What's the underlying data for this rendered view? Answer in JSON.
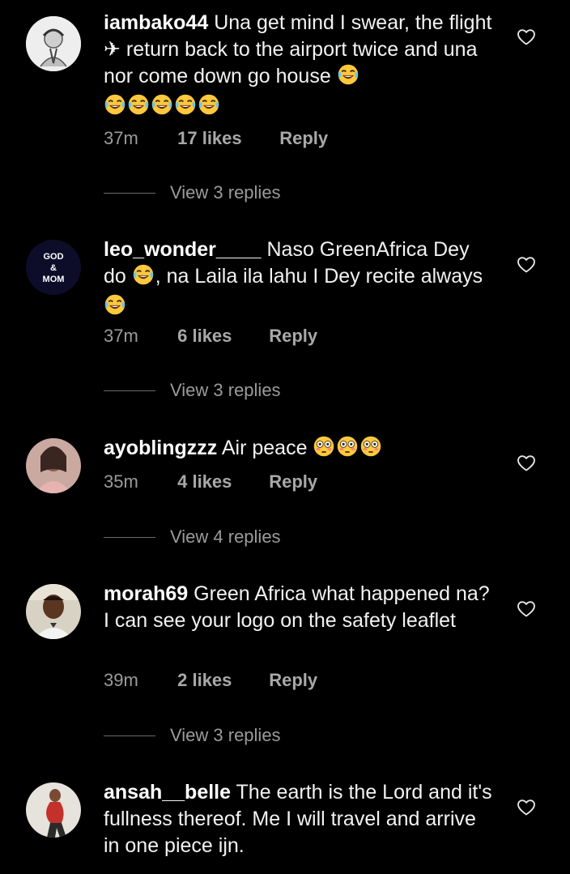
{
  "comments": [
    {
      "username": "iambako44",
      "text_parts": [
        "Una get mind I swear,  the flight ",
        " return back to the airport twice and una nor come down go house "
      ],
      "time": "37m",
      "likes": "17 likes",
      "reply": "Reply",
      "view_replies": "View 3 replies",
      "avatar_icon": "avatar-sketch-icon"
    },
    {
      "username": "leo_wonder____",
      "text_parts": [
        "Naso GreenAfrica Dey do ",
        ", na Laila ila lahu I Dey recite always "
      ],
      "time": "37m",
      "likes": "6 likes",
      "reply": "Reply",
      "view_replies": "View 3 replies",
      "avatar_text": [
        "GOD",
        "&",
        "MOM"
      ]
    },
    {
      "username": "ayoblingzzz",
      "text_parts": [
        "Air peace "
      ],
      "time": "35m",
      "likes": "4 likes",
      "reply": "Reply",
      "view_replies": "View 4 replies",
      "avatar_icon": "avatar-photo-icon"
    },
    {
      "username": "morah69",
      "text_parts": [
        "Green Africa what happened na? I can see your logo on the safety leaflet"
      ],
      "time": "39m",
      "likes": "2 likes",
      "reply": "Reply",
      "view_replies": "View 3 replies",
      "avatar_icon": "avatar-photo-icon"
    },
    {
      "username": "ansah__belle",
      "text_parts": [
        "The earth is the Lord and it's fullness thereof.  Me I will travel and arrive in one piece ijn."
      ],
      "avatar_icon": "avatar-photo-icon"
    }
  ],
  "icons": {
    "like": "heart-outline-icon",
    "airplane": "airplane-icon",
    "laugh": "tears-of-joy-emoji-icon",
    "flushed": "flushed-face-emoji-icon"
  },
  "colors": {
    "background": "#000000",
    "text": "#f2f2f2",
    "meta": "#9b9b9b"
  }
}
